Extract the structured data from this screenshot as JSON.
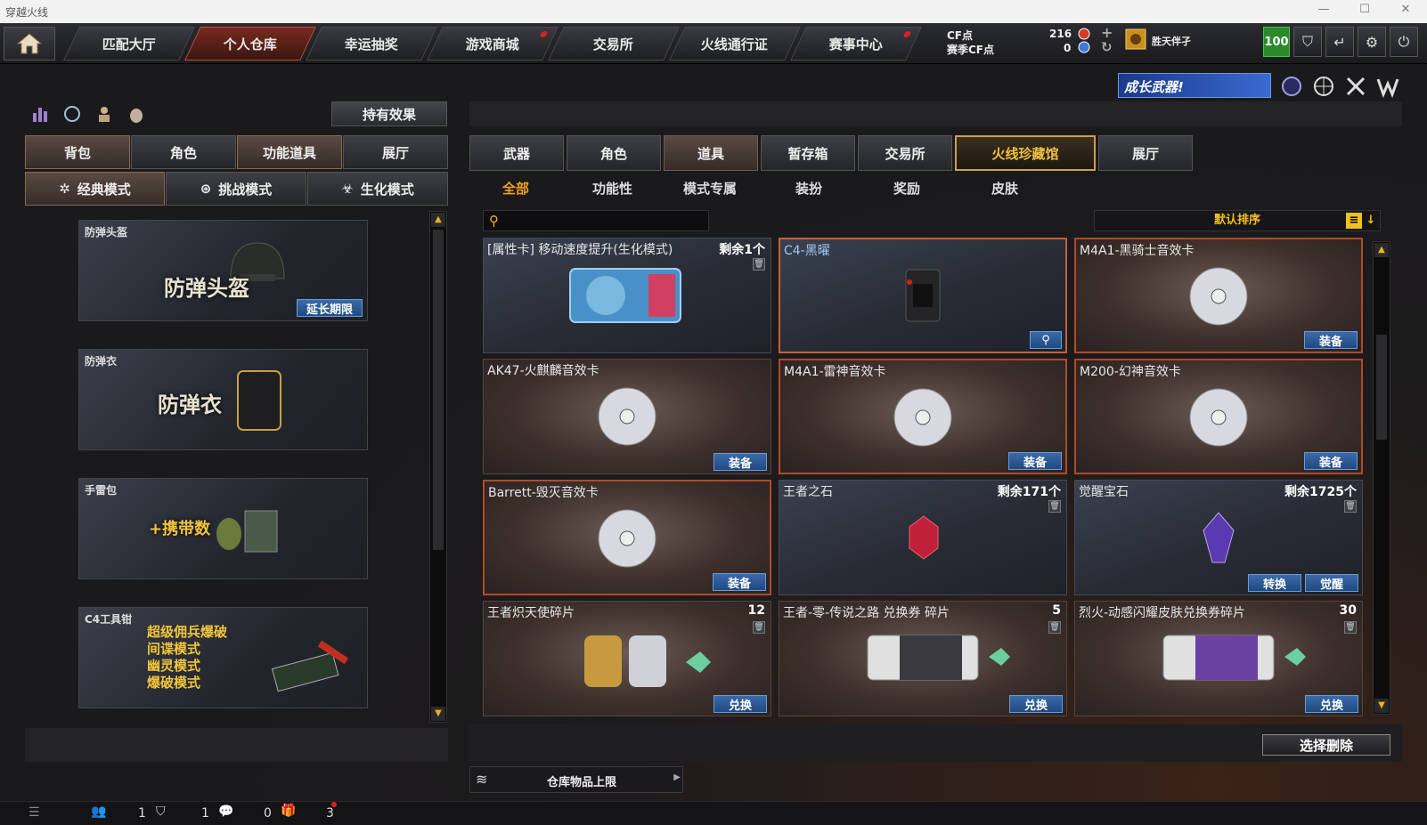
{
  "window": {
    "title": "穿越火线",
    "min": "—",
    "max": "☐",
    "close": "✕"
  },
  "nav": {
    "tabs": [
      {
        "label": "匹配大厅"
      },
      {
        "label": "个人仓库"
      },
      {
        "label": "幸运抽奖"
      },
      {
        "label": "游戏商城"
      },
      {
        "label": "交易所"
      },
      {
        "label": "火线通行证"
      },
      {
        "label": "赛事中心"
      }
    ]
  },
  "currency": {
    "cf_label": "CF点",
    "season_label": "赛季CF点",
    "cf_value": "216",
    "season_value": "0",
    "plus": "+",
    "refresh": "↻"
  },
  "user": {
    "name": "胜天伴孑",
    "level": "100"
  },
  "promo": {
    "text": "成长武器!"
  },
  "left": {
    "effect_button": "持有效果",
    "tabs": [
      "背包",
      "角色",
      "功能道具",
      "展厅"
    ],
    "modes": [
      "经典模式",
      "挑战模式",
      "生化模式"
    ],
    "cards": [
      {
        "label": "防弹头盔",
        "title": "防弹头盔",
        "button": "延长期限"
      },
      {
        "label": "防弹衣",
        "title": "防弹衣"
      },
      {
        "label": "手雷包",
        "title": "+携带数"
      },
      {
        "label": "C4工具钳",
        "lines": [
          "超级佣兵爆破",
          "间谍模式",
          "幽灵模式",
          "爆破模式"
        ]
      }
    ]
  },
  "main": {
    "tabs": [
      "武器",
      "角色",
      "道具",
      "暂存箱",
      "交易所",
      "火线珍藏馆",
      "展厅"
    ],
    "subtabs": [
      "全部",
      "功能性",
      "模式专属",
      "装扮",
      "奖励",
      "皮肤"
    ],
    "search_placeholder": "",
    "sort_label": "默认排序",
    "items": [
      {
        "name": "[属性卡] 移动速度提升(生化模式)",
        "qty": "剩余1个"
      },
      {
        "name": "C4-黑曜",
        "qty": ""
      },
      {
        "name": "M4A1-黑骑士音效卡",
        "qty": "",
        "button": "装备"
      },
      {
        "name": "AK47-火麒麟音效卡",
        "qty": "",
        "button": "装备"
      },
      {
        "name": "M4A1-雷神音效卡",
        "qty": "",
        "button": "装备"
      },
      {
        "name": "M200-幻神音效卡",
        "qty": "",
        "button": "装备"
      },
      {
        "name": "Barrett-毁灭音效卡",
        "qty": "",
        "button": "装备"
      },
      {
        "name": "王者之石",
        "qty": "剩余171个"
      },
      {
        "name": "觉醒宝石",
        "qty": "剩余1725个",
        "button": "转换",
        "button2": "觉醒"
      },
      {
        "name": "王者炽天使碎片",
        "qty": "12",
        "button": "兑换"
      },
      {
        "name": "王者-零-传说之路 兑换券 碎片",
        "qty": "5",
        "button": "兑换"
      },
      {
        "name": "烈火-动感闪耀皮肤兑换券碎片",
        "qty": "30",
        "button": "兑换"
      }
    ],
    "delete_button": "选择删除",
    "capacity_label": "仓库物品上限"
  },
  "bottom": {
    "counts": [
      "1",
      "1",
      "0",
      "3"
    ]
  }
}
